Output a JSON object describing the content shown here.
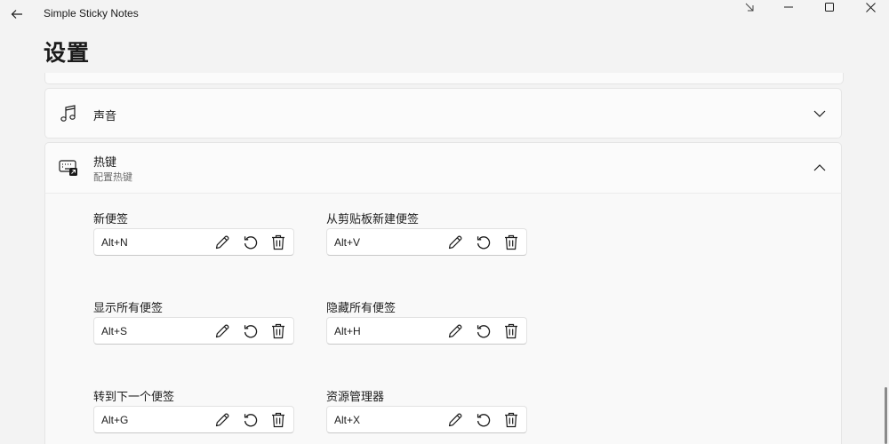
{
  "window": {
    "title": "Simple Sticky Notes",
    "icons": {
      "back": "arrow-left-icon",
      "pin": "arrow-down-right-icon",
      "minimize": "minimize-icon",
      "maximize": "maximize-icon",
      "close": "close-icon"
    }
  },
  "page": {
    "title": "设置"
  },
  "sections": {
    "sound": {
      "title": "声音",
      "icon": "music-note-icon",
      "expanded": false
    },
    "hotkeys": {
      "title": "热键",
      "subtitle": "配置热键",
      "icon": "keyboard-shortcut-icon",
      "expanded": true,
      "items": [
        {
          "label": "新便签",
          "value": "Alt+N"
        },
        {
          "label": "从剪贴板新建便签",
          "value": "Alt+V"
        },
        {
          "label": "显示所有便签",
          "value": "Alt+S"
        },
        {
          "label": "隐藏所有便签",
          "value": "Alt+H"
        },
        {
          "label": "转到下一个便签",
          "value": "Alt+G"
        },
        {
          "label": "资源管理器",
          "value": "Alt+X"
        }
      ],
      "item_icons": [
        "pencil-icon",
        "reset-icon",
        "trash-icon"
      ]
    }
  },
  "colors": {
    "background": "#f3f3f3",
    "card": "#fbfbfb",
    "text": "#1b1b1b",
    "subtext": "#6b6b6b"
  }
}
